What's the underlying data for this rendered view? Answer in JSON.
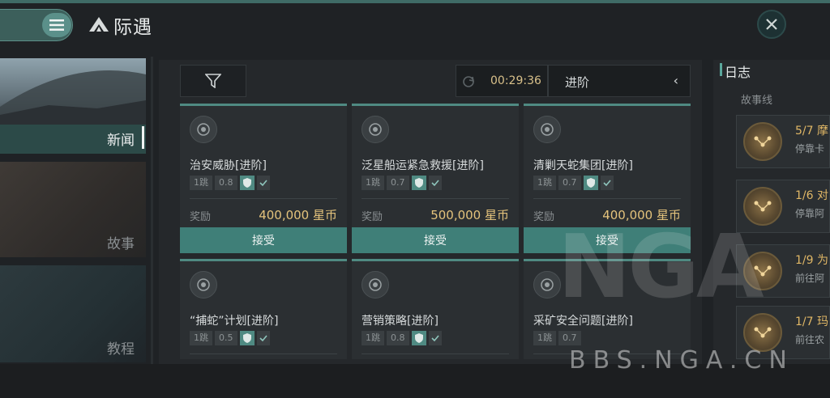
{
  "header": {
    "title": "际遇"
  },
  "nav": {
    "items": [
      {
        "label": "新闻",
        "active": true
      },
      {
        "label": "故事",
        "active": false
      },
      {
        "label": "教程",
        "active": false
      }
    ]
  },
  "toolbar": {
    "timer": "00:29:36",
    "tier": "进阶",
    "back_arrow": "‹"
  },
  "missions": [
    {
      "title": "治安威胁[进阶]",
      "jumps": "1跳",
      "rating": "0.8",
      "reward_label": "奖励",
      "reward": "400,000 星币",
      "accept": "接受"
    },
    {
      "title": "泛星船运紧急救援[进阶]",
      "jumps": "1跳",
      "rating": "0.7",
      "reward_label": "奖励",
      "reward": "500,000 星币",
      "accept": "接受"
    },
    {
      "title": "清剿天蛇集团[进阶]",
      "jumps": "1跳",
      "rating": "0.7",
      "reward_label": "奖励",
      "reward": "400,000 星币",
      "accept": "接受"
    },
    {
      "title": "“捕蛇”计划[进阶]",
      "jumps": "1跳",
      "rating": "0.5"
    },
    {
      "title": "营销策略[进阶]",
      "jumps": "1跳",
      "rating": "0.8"
    },
    {
      "title": "采矿安全问题[进阶]",
      "jumps": "1跳",
      "rating": "0.7"
    }
  ],
  "log": {
    "title": "日志",
    "subtitle": "故事线",
    "items": [
      {
        "progress": "5/7 摩",
        "desc": "停靠卡"
      },
      {
        "progress": "1/6 对",
        "desc": "停靠阿"
      },
      {
        "progress": "1/9 为",
        "desc": "前往阿"
      },
      {
        "progress": "1/7 玛",
        "desc": "前往农"
      }
    ]
  },
  "watermark": {
    "logo": "NGA",
    "site": "BBS.NGA.CN"
  },
  "colors": {
    "accent": "#4f8a82",
    "reward": "#e4c37c",
    "timer": "#d8c08a"
  },
  "icons": [
    "menu-icon",
    "title-logo-icon",
    "close-icon",
    "filter-icon",
    "refresh-icon",
    "mission-target-icon",
    "shield-icon",
    "check-icon",
    "storyline-node-icon"
  ]
}
